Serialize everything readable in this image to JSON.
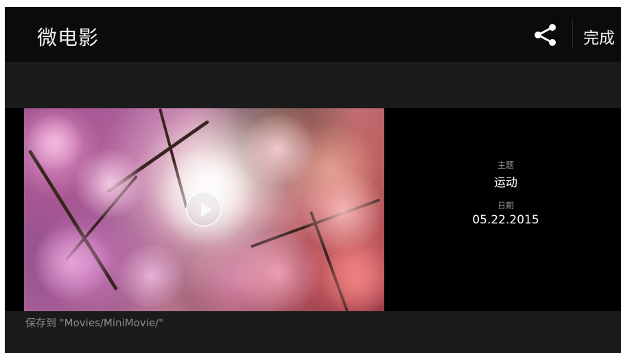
{
  "app": {
    "title": "微电影",
    "share_icon": "share-icon",
    "done_label": "完成"
  },
  "video": {
    "play_icon": "play-icon"
  },
  "details": {
    "theme_label": "主题",
    "theme_value": "运动",
    "date_label": "日期",
    "date_value": "05.22.2015"
  },
  "footer": {
    "save_path": "保存到 \"Movies/MiniMovie/\""
  }
}
